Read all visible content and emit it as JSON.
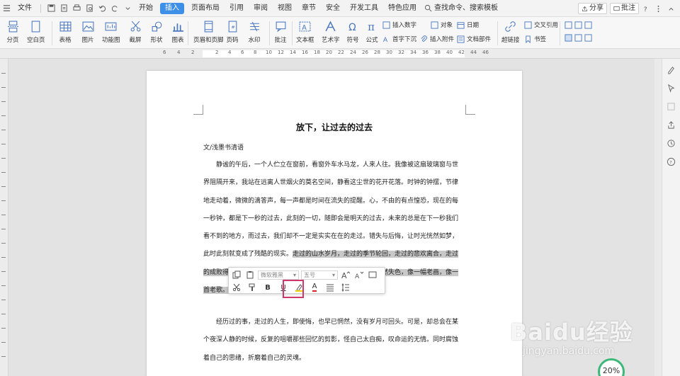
{
  "menubar": {
    "file_label": "文件",
    "tabs": [
      "开始",
      "插入",
      "页面布局",
      "引用",
      "审阅",
      "视图",
      "章节",
      "安全",
      "开发工具",
      "特色应用"
    ],
    "active_tab": "插入",
    "search_label": "查找命令、搜索模板",
    "share_label": "分享",
    "comment_label": "批注"
  },
  "ribbon": {
    "page_break": "分页",
    "blank_page": "空白页",
    "table": "表格",
    "picture": "图片",
    "function_chart": "功能图",
    "screenshot": "截屏",
    "shape": "形状",
    "chart": "图表",
    "header_footer": "页眉和页脚",
    "page_number": "页码",
    "watermark": "水印",
    "comment": "批注",
    "textbox": "文本框",
    "wordart": "艺术字",
    "symbol": "符号",
    "formula": "公式",
    "insert_number": "插入数字",
    "object": "对象",
    "date": "日期",
    "cross_ref": "交叉引用",
    "drop_cap": "首字下沉",
    "insert_attachment": "插入附件",
    "doc_part": "文档部件",
    "hyperlink": "超链接",
    "bookmark": "书签"
  },
  "ruler": {
    "left_numbers": [
      "6",
      "4",
      "2"
    ],
    "right_numbers": [
      "2",
      "4",
      "6",
      "8",
      "10",
      "12",
      "14",
      "16",
      "18",
      "20",
      "22",
      "24",
      "26",
      "28",
      "30",
      "32",
      "34",
      "36",
      "38",
      "40",
      "42",
      "44",
      "46"
    ]
  },
  "document": {
    "title": "放下，让过去的过去",
    "author": "文/浅墨书清语",
    "lines": [
      {
        "text": "静谧的午后，一个人伫立在窗前，看窗外车水马龙，人来人往。我像被这扇玻璃窗与世",
        "indent": true,
        "selected": false
      },
      {
        "text": "界阻隔开来，我站在远离人世烟火的莫名空间，静看这尘世的花开花落。时钟的钟摆，节律",
        "indent": false,
        "selected": false
      },
      {
        "text": "地走动着，微微的滴答声，每一声都是时间在流失的提醒。心，不由的有点惶恐，现在的每",
        "indent": false,
        "selected": false
      },
      {
        "text": "一秒钟，都是下一秒的过去，此刻的一切，随即会是明天的过去，未来的总是在下一秒我们",
        "indent": false,
        "selected": false
      },
      {
        "text": "看不到的地方，而过去，我们却不一定是实实在在的走过。错失与后悔，让时光恍然如梦，",
        "indent": false,
        "selected": false
      },
      {
        "text_plain": "此时此刻就变成了残酷的现实。",
        "text_sel": "走过的山水岁月，走过的季节轮回，走过的悲欢离合，走过",
        "indent": false,
        "selected": "partial"
      },
      {
        "text": "的成败得失……那些走过的，都会在时光的长河里越来越淡，黯然失色，像一幅老画，像一",
        "indent": false,
        "selected": true
      },
      {
        "text": "首老歌。",
        "indent": false,
        "selected": true
      }
    ],
    "lines2": [
      {
        "text": "经历过的事，走过的人生，即使悔，也早已惘然，没有岁月可回头。可是，却总会在某",
        "indent": true
      },
      {
        "text": "个夜深人静的时候，反复的咀嚼那些回忆的剪影，怪自己太自痴，叹命运的无情。同时腐蚀",
        "indent": false
      },
      {
        "text": "着自己的思绪，折磨着自己的灵魂。",
        "indent": false
      }
    ]
  },
  "float_toolbar": {
    "font_name": "微软雅黑",
    "font_size": "五号",
    "bold": "B",
    "underline": "U",
    "font_color_letter": "A"
  },
  "watermark": {
    "brand": "Baidu经验",
    "url": "jingyan.baidu.com"
  },
  "zoom_badge": "20%"
}
